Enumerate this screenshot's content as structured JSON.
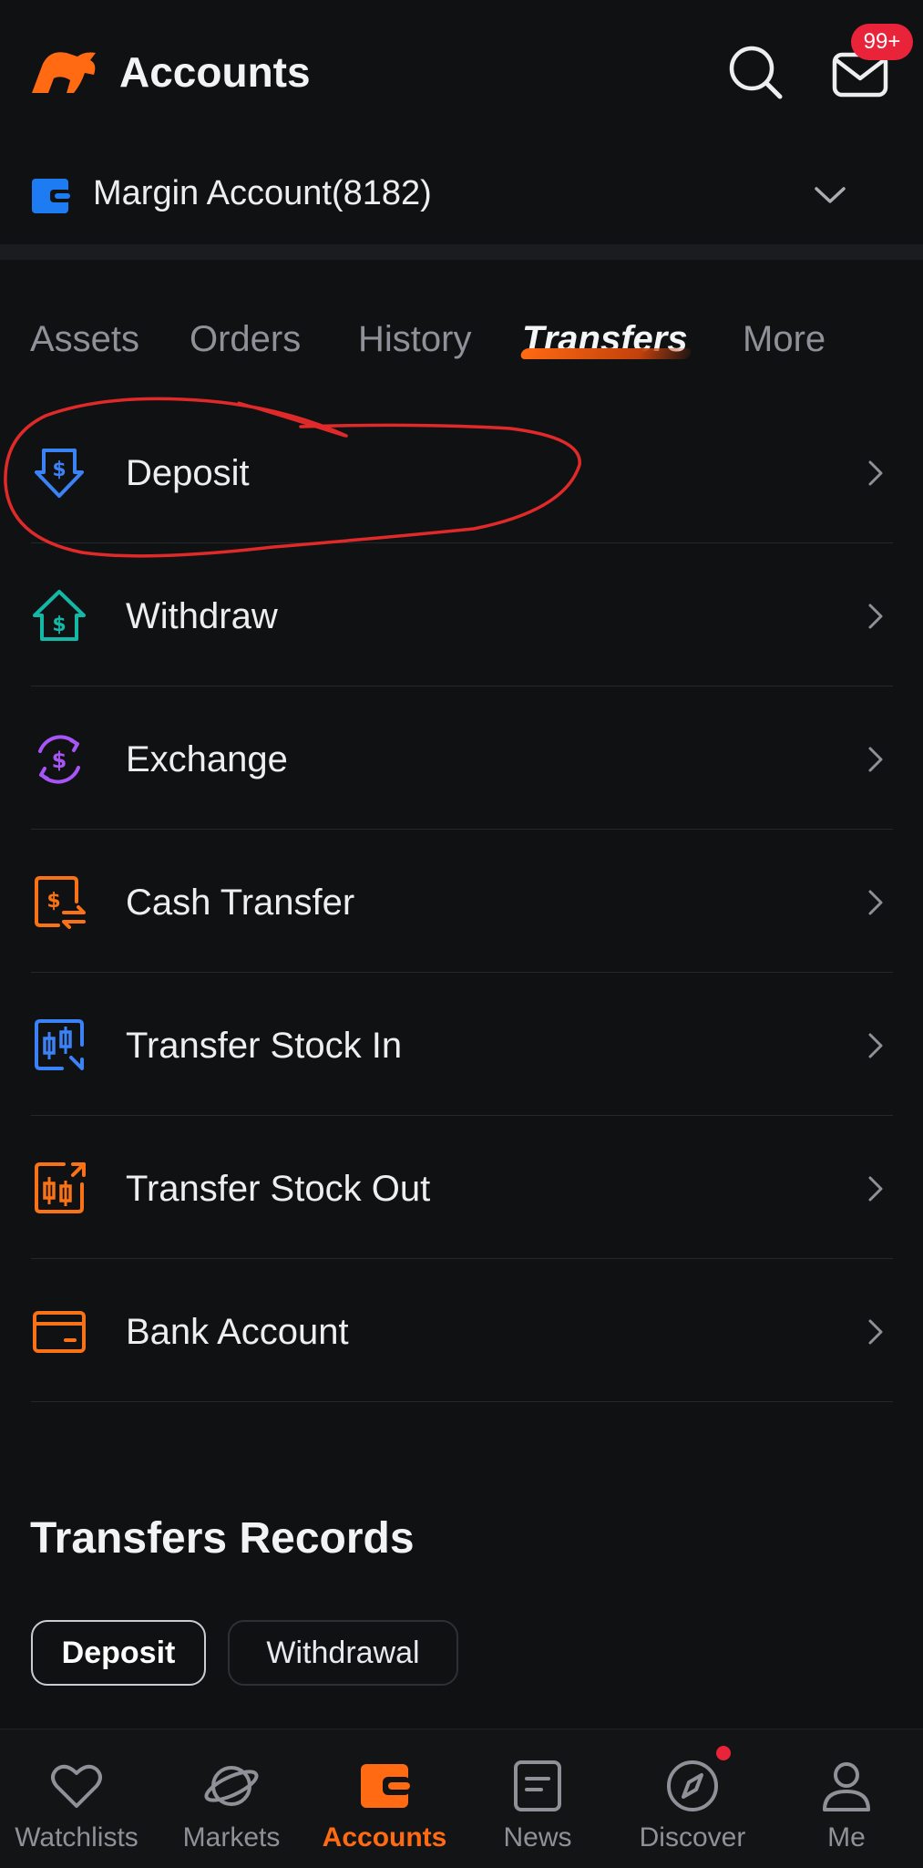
{
  "header": {
    "title": "Accounts",
    "mail_badge": "99+",
    "accent_color": "#ff6a13"
  },
  "account": {
    "name": "Margin Account(8182)"
  },
  "tabs": [
    {
      "label": "Assets",
      "active": false
    },
    {
      "label": "Orders",
      "active": false
    },
    {
      "label": "History",
      "active": false
    },
    {
      "label": "Transfers",
      "active": true
    },
    {
      "label": "More",
      "active": false
    }
  ],
  "menu": [
    {
      "label": "Deposit",
      "icon": "deposit-icon",
      "color": "#3b82f6"
    },
    {
      "label": "Withdraw",
      "icon": "withdraw-icon",
      "color": "#14b8a6"
    },
    {
      "label": "Exchange",
      "icon": "exchange-icon",
      "color": "#a855f7"
    },
    {
      "label": "Cash Transfer",
      "icon": "cash-transfer-icon",
      "color": "#f97316"
    },
    {
      "label": "Transfer Stock In",
      "icon": "stock-in-icon",
      "color": "#3b82f6"
    },
    {
      "label": "Transfer Stock Out",
      "icon": "stock-out-icon",
      "color": "#f97316"
    },
    {
      "label": "Bank Account",
      "icon": "bank-card-icon",
      "color": "#f97316"
    }
  ],
  "records": {
    "title": "Transfers Records",
    "chips": [
      {
        "label": "Deposit",
        "active": true
      },
      {
        "label": "Withdrawal",
        "active": false
      }
    ]
  },
  "bottom_nav": [
    {
      "label": "Watchlists",
      "icon": "heart-icon",
      "active": false
    },
    {
      "label": "Markets",
      "icon": "planet-icon",
      "active": false
    },
    {
      "label": "Accounts",
      "icon": "wallet-icon",
      "active": true
    },
    {
      "label": "News",
      "icon": "news-icon",
      "active": false
    },
    {
      "label": "Discover",
      "icon": "compass-icon",
      "active": false,
      "has_dot": true
    },
    {
      "label": "Me",
      "icon": "person-icon",
      "active": false
    }
  ]
}
